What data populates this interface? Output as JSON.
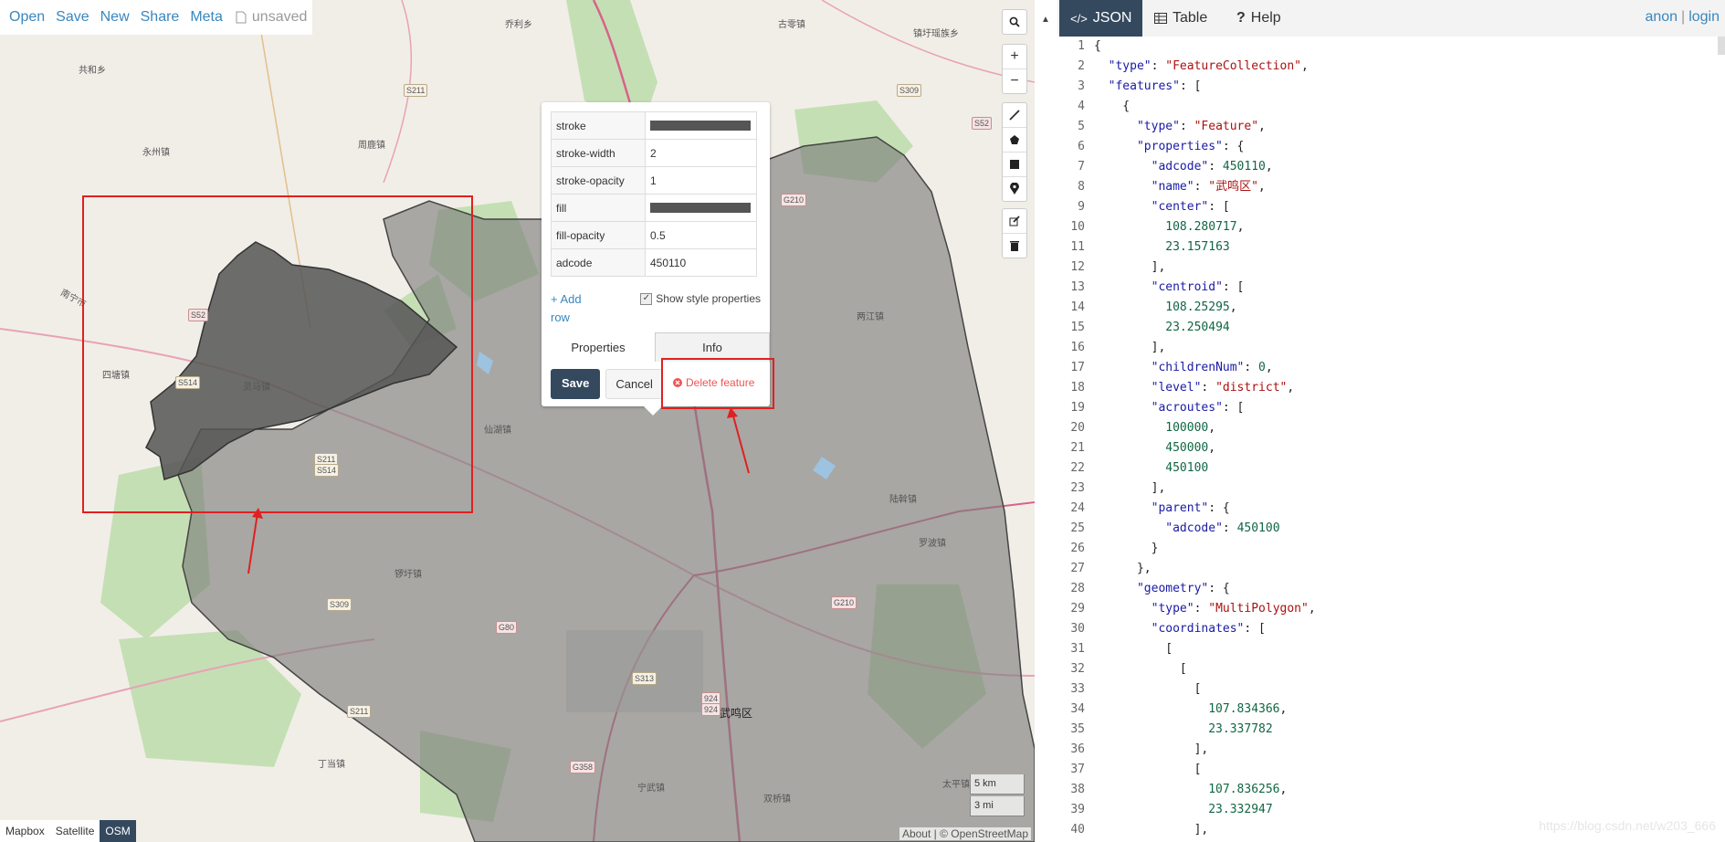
{
  "menu": {
    "open": "Open",
    "save": "Save",
    "new": "New",
    "share": "Share",
    "meta": "Meta",
    "status": "unsaved"
  },
  "map_labels": {
    "l1": "乔利乡",
    "l2": "古零镇",
    "l3": "镇圩瑶族乡",
    "l4": "共和乡",
    "l5": "永州镇",
    "l6": "周鹿镇",
    "l7": "四塘镇",
    "l8": "灵马镇",
    "l9": "仙湖镇",
    "l10": "两江镇",
    "l11": "陆斡镇",
    "l12": "罗波镇",
    "l13": "锣圩镇",
    "l14": "武鸣区",
    "l15": "丁当镇",
    "l16": "宁武镇",
    "l17": "双桥镇",
    "l18": "太平镇",
    "l19": "南宁市"
  },
  "shields": {
    "s1": "S211",
    "s2": "S309",
    "s3": "S52",
    "s4": "G210",
    "s5": "S52",
    "s6": "S514",
    "s7": "S211",
    "s8": "S514",
    "s9": "S309",
    "s10": "G80",
    "s11": "S313",
    "s12": "G210",
    "s13": "S211",
    "s14": "G358",
    "s15": "924",
    "s16": "924"
  },
  "popup": {
    "rows": [
      {
        "key": "stroke",
        "value": ""
      },
      {
        "key": "stroke-width",
        "value": "2"
      },
      {
        "key": "stroke-opacity",
        "value": "1"
      },
      {
        "key": "fill",
        "value": ""
      },
      {
        "key": "fill-opacity",
        "value": "0.5"
      },
      {
        "key": "adcode",
        "value": "450110"
      }
    ],
    "add_row": "+ Add row",
    "show_style": "Show style properties",
    "tab_properties": "Properties",
    "tab_info": "Info",
    "save": "Save",
    "cancel": "Cancel",
    "delete": "Delete feature"
  },
  "layers": {
    "mapbox": "Mapbox",
    "satellite": "Satellite",
    "osm": "OSM"
  },
  "scale": {
    "km": "5 km",
    "mi": "3 mi"
  },
  "attribution": "About | © OpenStreetMap",
  "panel": {
    "tab_json": "JSON",
    "tab_table": "Table",
    "tab_help": "Help",
    "user_anon": "anon",
    "user_sep": "|",
    "user_login": "login",
    "watermark": "https://blog.csdn.net/w203_666"
  },
  "code_lines": [
    "{",
    "  \"type\": \"FeatureCollection\",",
    "  \"features\": [",
    "    {",
    "      \"type\": \"Feature\",",
    "      \"properties\": {",
    "        \"adcode\": 450110,",
    "        \"name\": \"武鸣区\",",
    "        \"center\": [",
    "          108.280717,",
    "          23.157163",
    "        ],",
    "        \"centroid\": [",
    "          108.25295,",
    "          23.250494",
    "        ],",
    "        \"childrenNum\": 0,",
    "        \"level\": \"district\",",
    "        \"acroutes\": [",
    "          100000,",
    "          450000,",
    "          450100",
    "        ],",
    "        \"parent\": {",
    "          \"adcode\": 450100",
    "        }",
    "      },",
    "      \"geometry\": {",
    "        \"type\": \"MultiPolygon\",",
    "        \"coordinates\": [",
    "          [",
    "            [",
    "              [",
    "                107.834366,",
    "                23.337782",
    "              ],",
    "              [",
    "                107.836256,",
    "                23.332947",
    "              ],"
  ]
}
